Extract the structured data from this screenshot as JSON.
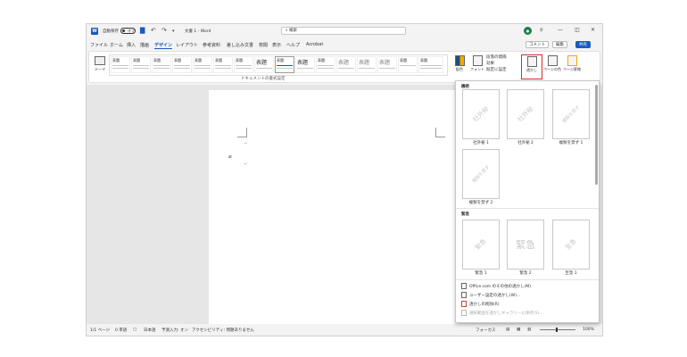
{
  "titlebar": {
    "app_logo": "W",
    "autosave_label": "自動保存",
    "autosave_state": "オフ",
    "doc_title": "文書 1 - Word",
    "search_placeholder": "検索",
    "avatar_initial": "●",
    "minimize": "—",
    "restore": "◫",
    "close": "✕"
  },
  "menu": {
    "items": [
      "ファイル",
      "ホーム",
      "挿入",
      "描画",
      "デザイン",
      "レイアウト",
      "参考資料",
      "差し込み文書",
      "校閲",
      "表示",
      "ヘルプ",
      "Acrobat"
    ],
    "comments_btn": "コメント",
    "edit_btn": "編集",
    "share_btn": "共有"
  },
  "ribbon": {
    "theme_label": "テーマ",
    "style_thumbs": [
      "表題",
      "表題",
      "表題",
      "表題",
      "表題",
      "表題",
      "表題",
      "表題",
      "表題",
      "表題",
      "表題",
      "表題",
      "表題",
      "表題",
      "表題",
      "表題"
    ],
    "big_titles": [
      "表題",
      "表題",
      "表題",
      "表題"
    ],
    "gallery_label": "ドキュメントの書式設定",
    "colors_label": "配色",
    "fonts_label": "フォント",
    "para_spacing": "段落の間隔",
    "effects": "効果",
    "set_default": "既定に設定",
    "watermark_btn": "透かし",
    "page_color_btn": "ページの色",
    "page_border_btn": "ページ罫線"
  },
  "panel": {
    "section1": "機密",
    "section2": "緊急",
    "watermarks1": [
      {
        "text": "社外秘",
        "label": "社外秘 1"
      },
      {
        "text": "社外秘",
        "label": "社外秘 2"
      },
      {
        "text": "複製を禁ず",
        "label": "複製を禁ず 1"
      },
      {
        "text": "複製を禁ず",
        "label": "複製を禁ず 2"
      }
    ],
    "watermarks2": [
      {
        "text": "緊急",
        "label": "緊急 1"
      },
      {
        "text": "緊急",
        "label": "緊急 2"
      },
      {
        "text": "至急",
        "label": "至急 1"
      }
    ],
    "commands": [
      "Office.com のその他の透かし(M)",
      "ユーザー設定の透かし(W)...",
      "透かしの削除(R)",
      "選択範囲を透かしギャラリーに保存(S)..."
    ]
  },
  "status": {
    "page": "1/1 ページ",
    "words": "0 単語",
    "language": "日本語",
    "ime": "予測入力: オン",
    "accessibility": "アクセシビリティ: 問題ありません",
    "focus": "フォーカス",
    "zoom": "100%"
  }
}
